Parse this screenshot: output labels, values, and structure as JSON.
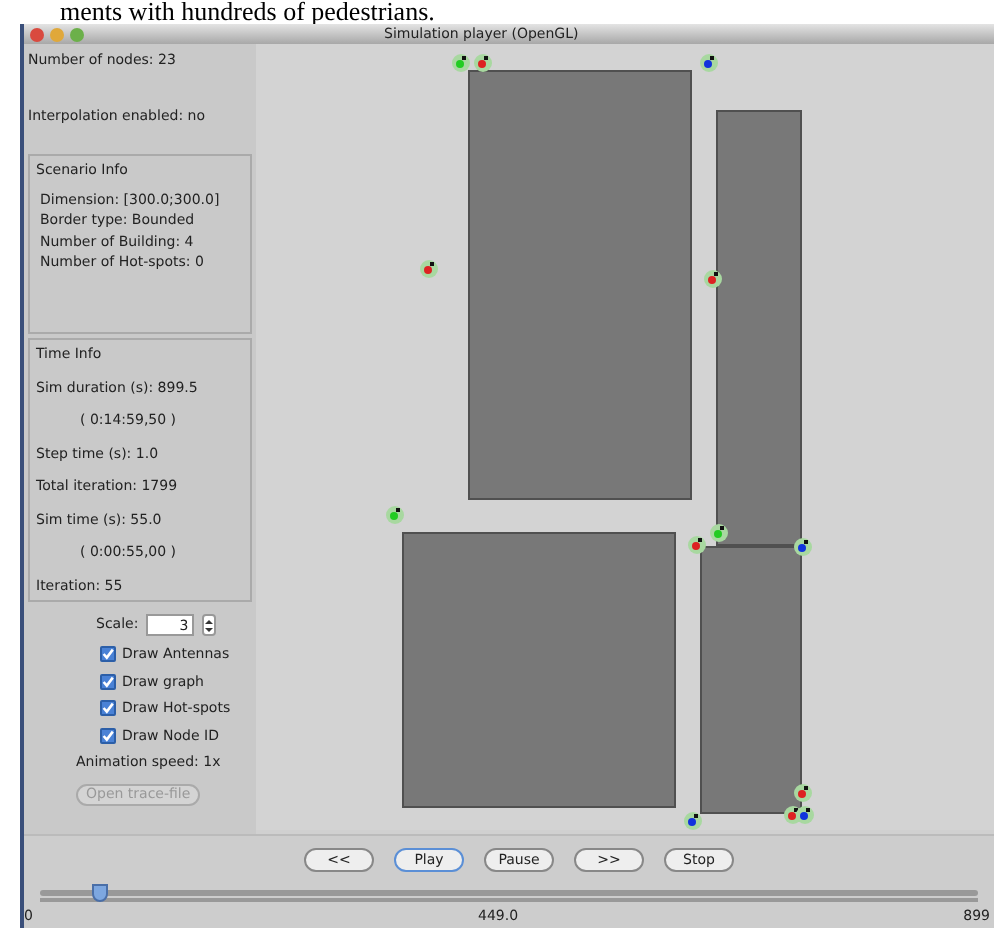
{
  "caption": "ments with hundreds of pedestrians.",
  "window": {
    "title": "Simulation player (OpenGL)"
  },
  "info": {
    "nodes": "Number of nodes: 23",
    "interpolation": "Interpolation enabled: no"
  },
  "scenario_info": {
    "title": "Scenario Info",
    "lines": [
      "Dimension: [300.0;300.0]",
      "Border type: Bounded",
      "Number of Building: 4",
      "Number of Hot-spots: 0"
    ]
  },
  "time_info": {
    "title": "Time Info",
    "lines": [
      {
        "text": "Sim duration (s): 899.5",
        "indent": false
      },
      {
        "text": "( 0:14:59,50 )",
        "indent": true
      },
      {
        "text": "Step time (s): 1.0",
        "indent": false
      },
      {
        "text": "Total iteration: 1799",
        "indent": false
      },
      {
        "text": "Sim time (s):  55.0",
        "indent": false
      },
      {
        "text": "( 0:00:55,00 )",
        "indent": true
      },
      {
        "text": "Iteration:  55",
        "indent": false
      }
    ]
  },
  "scale": {
    "label": "Scale:",
    "value": "3"
  },
  "options": [
    {
      "label": "Draw Antennas",
      "checked": true
    },
    {
      "label": "Draw graph",
      "checked": true
    },
    {
      "label": "Draw Hot-spots",
      "checked": true
    },
    {
      "label": "Draw Node ID",
      "checked": true
    }
  ],
  "animation_speed": "Animation speed: 1x",
  "open_button": {
    "label": "Open trace-file",
    "disabled": true
  },
  "nodes": [
    {
      "color": "#22cc22"
    },
    {
      "color": "#dd2222"
    },
    {
      "color": "#1133dd"
    },
    {
      "color": "#dd2222"
    },
    {
      "color": "#dd2222"
    },
    {
      "color": "#22cc22"
    },
    {
      "color": "#dd2222"
    },
    {
      "color": "#22cc22"
    },
    {
      "color": "#1133dd"
    },
    {
      "color": "#dd2222"
    },
    {
      "color": "#dd2222"
    },
    {
      "color": "#1133dd"
    },
    {
      "color": "#1133dd"
    }
  ],
  "controls": [
    {
      "label": "<<",
      "default": false
    },
    {
      "label": "Play",
      "default": true
    },
    {
      "label": "Pause",
      "default": false
    },
    {
      "label": ">>",
      "default": false
    },
    {
      "label": "Stop",
      "default": false
    }
  ],
  "timeline": {
    "level": 0.065,
    "labels": [
      "0",
      "449.0",
      "899"
    ]
  }
}
